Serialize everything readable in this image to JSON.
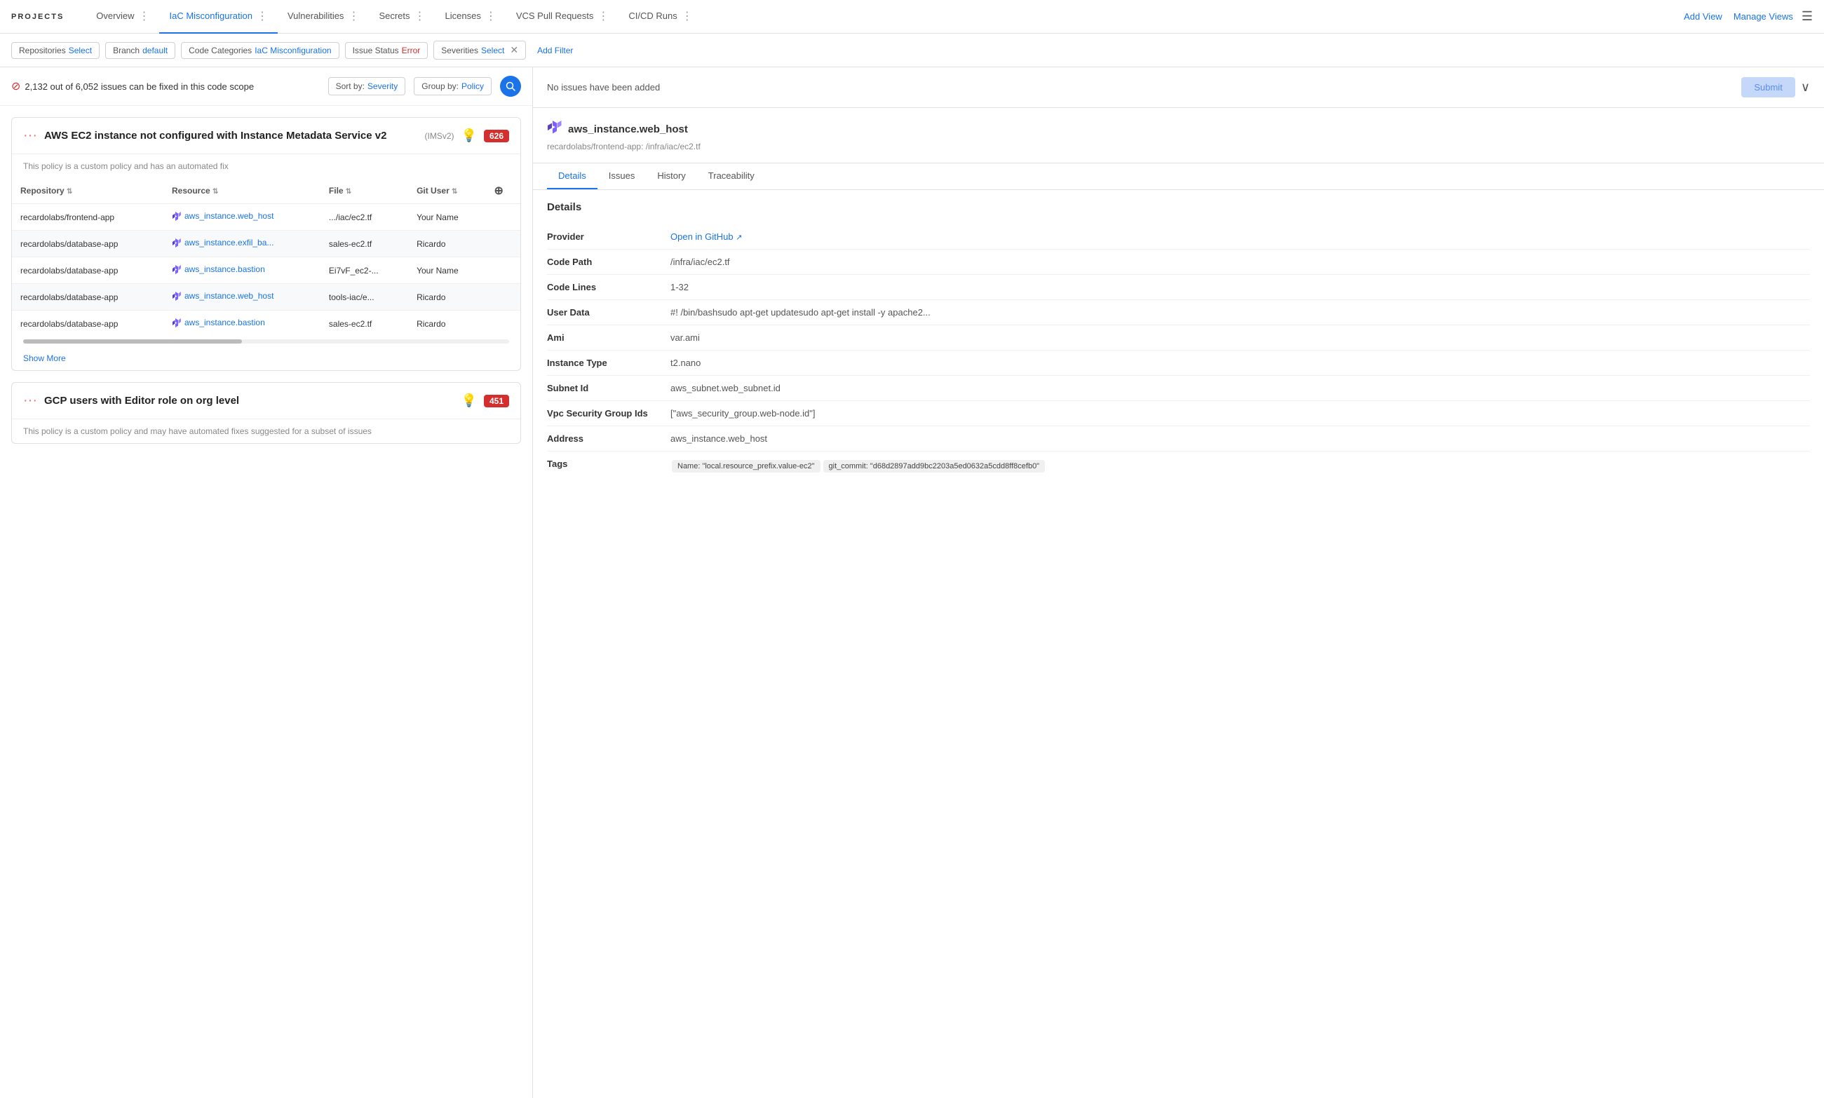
{
  "nav": {
    "projects_label": "PROJECTS",
    "items": [
      {
        "id": "overview",
        "label": "Overview",
        "active": false
      },
      {
        "id": "iac",
        "label": "IaC Misconfiguration",
        "active": true
      },
      {
        "id": "vulnerabilities",
        "label": "Vulnerabilities",
        "active": false
      },
      {
        "id": "secrets",
        "label": "Secrets",
        "active": false
      },
      {
        "id": "licenses",
        "label": "Licenses",
        "active": false
      },
      {
        "id": "vcs",
        "label": "VCS Pull Requests",
        "active": false
      },
      {
        "id": "cicd",
        "label": "CI/CD Runs",
        "active": false
      }
    ],
    "add_view": "Add View",
    "manage_views": "Manage Views"
  },
  "filters": {
    "chips": [
      {
        "label": "Repositories",
        "value": "Select",
        "closeable": false
      },
      {
        "label": "Branch",
        "value": "default",
        "closeable": false
      },
      {
        "label": "Code Categories",
        "value": "IaC Misconfiguration",
        "closeable": false
      },
      {
        "label": "Issue Status",
        "value": "Error",
        "closeable": false,
        "value_color": "red"
      },
      {
        "label": "Severities",
        "value": "Select",
        "closeable": true
      }
    ],
    "add_filter": "Add Filter"
  },
  "issues_header": {
    "count_text": "2,132 out of 6,052 issues can be fixed in this code scope",
    "sort_label": "Sort by:",
    "sort_value": "Severity",
    "group_label": "Group by:",
    "group_value": "Policy"
  },
  "issue_card_1": {
    "title": "AWS EC2 instance not configured with Instance Metadata Service v2",
    "subtitle_suffix": "(IMSv2)",
    "description": "This policy is a custom policy and has an automated fix",
    "badge": "626",
    "columns": [
      "Repository",
      "Resource",
      "File",
      "Git User"
    ],
    "rows": [
      {
        "repo": "recardolabs/frontend-app",
        "resource": "aws_instance.web_host",
        "file": ".../iac/ec2.tf",
        "user": "Your Name"
      },
      {
        "repo": "recardolabs/database-app",
        "resource": "aws_instance.exfil_ba...",
        "file": "sales-ec2.tf",
        "user": "Ricardo"
      },
      {
        "repo": "recardolabs/database-app",
        "resource": "aws_instance.bastion",
        "file": "Ei7vF_ec2-...",
        "user": "Your Name"
      },
      {
        "repo": "recardolabs/database-app",
        "resource": "aws_instance.web_host",
        "file": "tools-iac/e...",
        "user": "Ricardo"
      },
      {
        "repo": "recardolabs/database-app",
        "resource": "aws_instance.bastion",
        "file": "sales-ec2.tf",
        "user": "Ricardo"
      }
    ],
    "show_more": "Show More"
  },
  "issue_card_2": {
    "title": "GCP users with Editor role on org level",
    "description": "This policy is a custom policy and may have automated fixes suggested for a subset of issues",
    "badge": "451"
  },
  "right_panel": {
    "no_issues": "No issues have been added",
    "submit_btn": "Submit",
    "resource_title": "aws_instance.web_host",
    "resource_path": "recardolabs/frontend-app: /infra/iac/ec2.tf",
    "tabs": [
      "Details",
      "Issues",
      "History",
      "Traceability"
    ],
    "active_tab": "Details",
    "details_section_title": "Details",
    "details": [
      {
        "key": "Provider",
        "value": "Open in GitHub",
        "is_link": true
      },
      {
        "key": "Code Path",
        "value": "/infra/iac/ec2.tf",
        "is_link": false
      },
      {
        "key": "Code Lines",
        "value": "1-32",
        "is_link": false
      },
      {
        "key": "User Data",
        "value": "#! /bin/bashsudo apt-get updatesudo apt-get install -y apache2...",
        "is_link": false
      },
      {
        "key": "Ami",
        "value": "var.ami",
        "is_link": false
      },
      {
        "key": "Instance Type",
        "value": "t2.nano",
        "is_link": false
      },
      {
        "key": "Subnet Id",
        "value": "aws_subnet.web_subnet.id",
        "is_link": false
      },
      {
        "key": "Vpc Security Group Ids",
        "value": "[\"aws_security_group.web-node.id\"]",
        "is_link": false
      },
      {
        "key": "Address",
        "value": "aws_instance.web_host",
        "is_link": false
      },
      {
        "key": "Tags",
        "value": "",
        "is_link": false,
        "tags": [
          "Name: \"local.resource_prefix.value-ec2\"",
          "git_commit: \"d68d2897add9bc2203a5ed0632a5cdd8ff8cefb0\""
        ]
      }
    ]
  }
}
